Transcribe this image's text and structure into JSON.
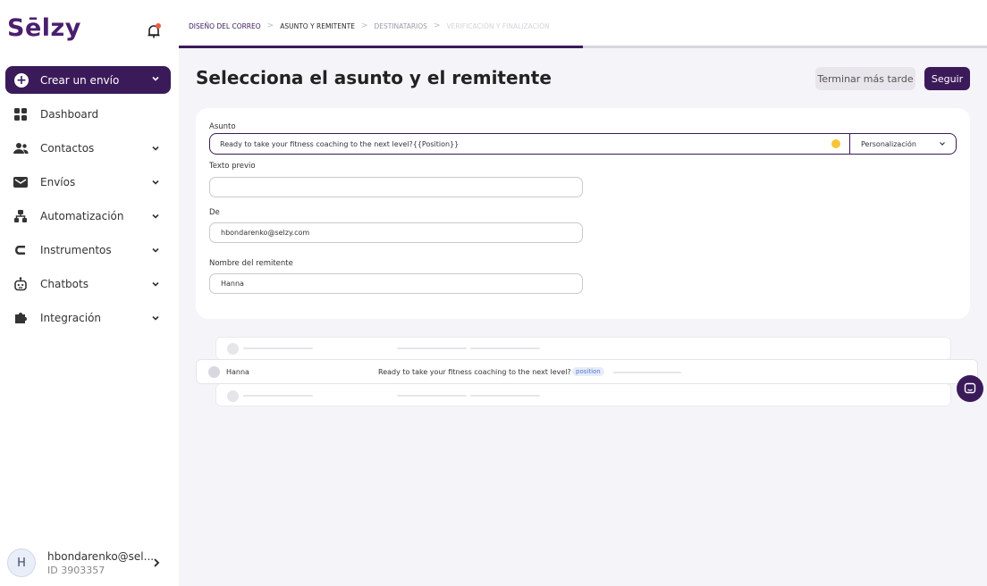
{
  "app": {
    "logo": "Sēlzy"
  },
  "sidebar": {
    "primary": {
      "label": "Crear un envío"
    },
    "items": [
      {
        "label": "Dashboard",
        "icon": "grid-icon"
      },
      {
        "label": "Contactos",
        "icon": "users-icon"
      },
      {
        "label": "Envíos",
        "icon": "mail-icon"
      },
      {
        "label": "Automatización",
        "icon": "flow-icon"
      },
      {
        "label": "Instrumentos",
        "icon": "tools-icon"
      },
      {
        "label": "Chatbots",
        "icon": "bot-icon"
      },
      {
        "label": "Integración",
        "icon": "puzzle-icon"
      }
    ],
    "user": {
      "initial": "H",
      "email": "hbondarenko@sel...",
      "id": "ID 3903357"
    }
  },
  "breadcrumb": {
    "steps": [
      "DISEÑO DEL CORREO",
      "ASUNTO Y REMITENTE",
      "DESTINATARIOS",
      "VERIFICACIÓN Y FINALIZACIÓN"
    ],
    "progress_pct": 50
  },
  "header": {
    "title": "Selecciona el asunto y el remitente",
    "later_label": "Terminar más tarde",
    "next_label": "Seguir"
  },
  "form": {
    "subject_label": "Asunto",
    "subject_value": "Ready to take your fitness coaching to the next level?{{Position}}",
    "personalization_label": "Personalización",
    "preheader_label": "Texto previo",
    "preheader_value": "",
    "from_label": "De",
    "from_value": "hbondarenko@selzy.com",
    "sender_label": "Nombre del remitente",
    "sender_value": "Hanna"
  },
  "preview": {
    "sender": "Hanna",
    "subject": "Ready to take your fitness coaching to the next level?",
    "tag": "position"
  },
  "colors": {
    "brand": "#3b1a5a",
    "background": "#f5f4f8"
  }
}
